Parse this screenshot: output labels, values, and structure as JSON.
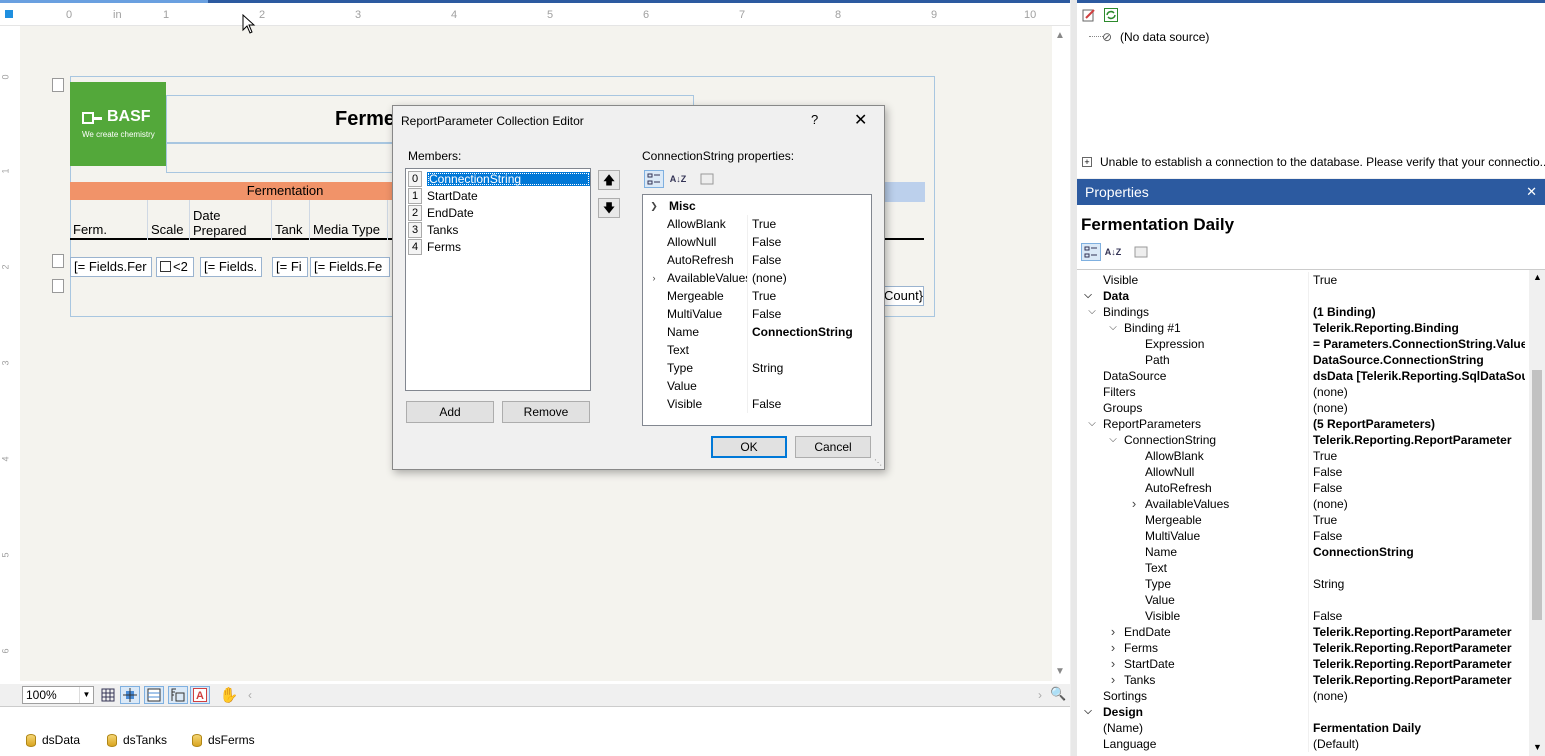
{
  "ruler": {
    "unit": "in",
    "marks": [
      "0",
      "1",
      "2",
      "3",
      "4",
      "5",
      "6",
      "7",
      "8",
      "9",
      "10"
    ]
  },
  "report": {
    "title_partial": "Ferme",
    "logo": {
      "brand": "BASF",
      "tagline": "We create chemistry"
    },
    "band_label": "Fermentation",
    "columns": [
      "Ferm.",
      "Scale",
      "Date Prepared",
      "Tank",
      "Media Type"
    ],
    "detail_cells": [
      "[= Fields.Fer",
      "<2",
      "[= Fields.",
      "[= Fi",
      "[= Fields.Fe"
    ],
    "footer_cell": "Count}"
  },
  "design_status": {
    "zoom": "100%"
  },
  "tray": {
    "components": [
      "dsData",
      "dsTanks",
      "dsFerms"
    ]
  },
  "dialog": {
    "title": "ReportParameter Collection Editor",
    "help": "?",
    "members_label": "Members:",
    "members": [
      {
        "index": "0",
        "name": "ConnectionString"
      },
      {
        "index": "1",
        "name": "StartDate"
      },
      {
        "index": "2",
        "name": "EndDate"
      },
      {
        "index": "3",
        "name": "Tanks"
      },
      {
        "index": "4",
        "name": "Ferms"
      }
    ],
    "add_label": "Add",
    "remove_label": "Remove",
    "props_label": "ConnectionString properties:",
    "category": "Misc",
    "properties": [
      {
        "key": "AllowBlank",
        "value": "True"
      },
      {
        "key": "AllowNull",
        "value": "False"
      },
      {
        "key": "AutoRefresh",
        "value": "False"
      },
      {
        "key": "AvailableValues",
        "value": "(none)"
      },
      {
        "key": "Mergeable",
        "value": "True"
      },
      {
        "key": "MultiValue",
        "value": "False"
      },
      {
        "key": "Name",
        "value": "ConnectionString"
      },
      {
        "key": "Text",
        "value": ""
      },
      {
        "key": "Type",
        "value": "String"
      },
      {
        "key": "Value",
        "value": ""
      },
      {
        "key": "Visible",
        "value": "False"
      }
    ],
    "ok_label": "OK",
    "cancel_label": "Cancel"
  },
  "data_explorer": {
    "no_source": "(No data source)",
    "error": "Unable to establish a connection to the database. Please verify that your connectio..."
  },
  "properties_panel": {
    "header": "Properties",
    "object_name": "Fermentation Daily",
    "rows": [
      {
        "key": "Visible",
        "value": "True",
        "level": 0
      },
      {
        "key": "Data",
        "value": "",
        "level": -1
      },
      {
        "key": "Bindings",
        "value": "(1 Binding)",
        "level": 0,
        "exp": "v",
        "bold": true
      },
      {
        "key": "Binding #1",
        "value": "Telerik.Reporting.Binding",
        "level": 1,
        "exp": "v",
        "bold": true
      },
      {
        "key": "Expression",
        "value": "= Parameters.ConnectionString.Value",
        "level": 2,
        "bold": true
      },
      {
        "key": "Path",
        "value": "DataSource.ConnectionString",
        "level": 2,
        "bold": true
      },
      {
        "key": "DataSource",
        "value": "dsData [Telerik.Reporting.SqlDataSource]",
        "level": 0,
        "bold": true
      },
      {
        "key": "Filters",
        "value": "(none)",
        "level": 0
      },
      {
        "key": "Groups",
        "value": "(none)",
        "level": 0
      },
      {
        "key": "ReportParameters",
        "value": "(5 ReportParameters)",
        "level": 0,
        "exp": "v",
        "bold": true
      },
      {
        "key": "ConnectionString",
        "value": "Telerik.Reporting.ReportParameter",
        "level": 1,
        "exp": "v",
        "bold": true
      },
      {
        "key": "AllowBlank",
        "value": "True",
        "level": 2
      },
      {
        "key": "AllowNull",
        "value": "False",
        "level": 2
      },
      {
        "key": "AutoRefresh",
        "value": "False",
        "level": 2
      },
      {
        "key": "AvailableValues",
        "value": "(none)",
        "level": 2,
        "exp": ">"
      },
      {
        "key": "Mergeable",
        "value": "True",
        "level": 2
      },
      {
        "key": "MultiValue",
        "value": "False",
        "level": 2
      },
      {
        "key": "Name",
        "value": "ConnectionString",
        "level": 2,
        "bold": true
      },
      {
        "key": "Text",
        "value": "",
        "level": 2
      },
      {
        "key": "Type",
        "value": "String",
        "level": 2
      },
      {
        "key": "Value",
        "value": "",
        "level": 2
      },
      {
        "key": "Visible",
        "value": "False",
        "level": 2
      },
      {
        "key": "EndDate",
        "value": "Telerik.Reporting.ReportParameter",
        "level": 1,
        "exp": ">",
        "bold": true
      },
      {
        "key": "Ferms",
        "value": "Telerik.Reporting.ReportParameter",
        "level": 1,
        "exp": ">",
        "bold": true
      },
      {
        "key": "StartDate",
        "value": "Telerik.Reporting.ReportParameter",
        "level": 1,
        "exp": ">",
        "bold": true
      },
      {
        "key": "Tanks",
        "value": "Telerik.Reporting.ReportParameter",
        "level": 1,
        "exp": ">",
        "bold": true
      },
      {
        "key": "Sortings",
        "value": "(none)",
        "level": 0
      },
      {
        "key": "Design",
        "value": "",
        "level": -1
      },
      {
        "key": "(Name)",
        "value": "Fermentation Daily",
        "level": 0,
        "bold": true
      },
      {
        "key": "Language",
        "value": "(Default)",
        "level": 0
      }
    ]
  },
  "colors": {
    "accent": "#0078d7",
    "props_header": "#2c5aa0",
    "basf_green": "#53a83a",
    "band_orange": "#f19369"
  }
}
